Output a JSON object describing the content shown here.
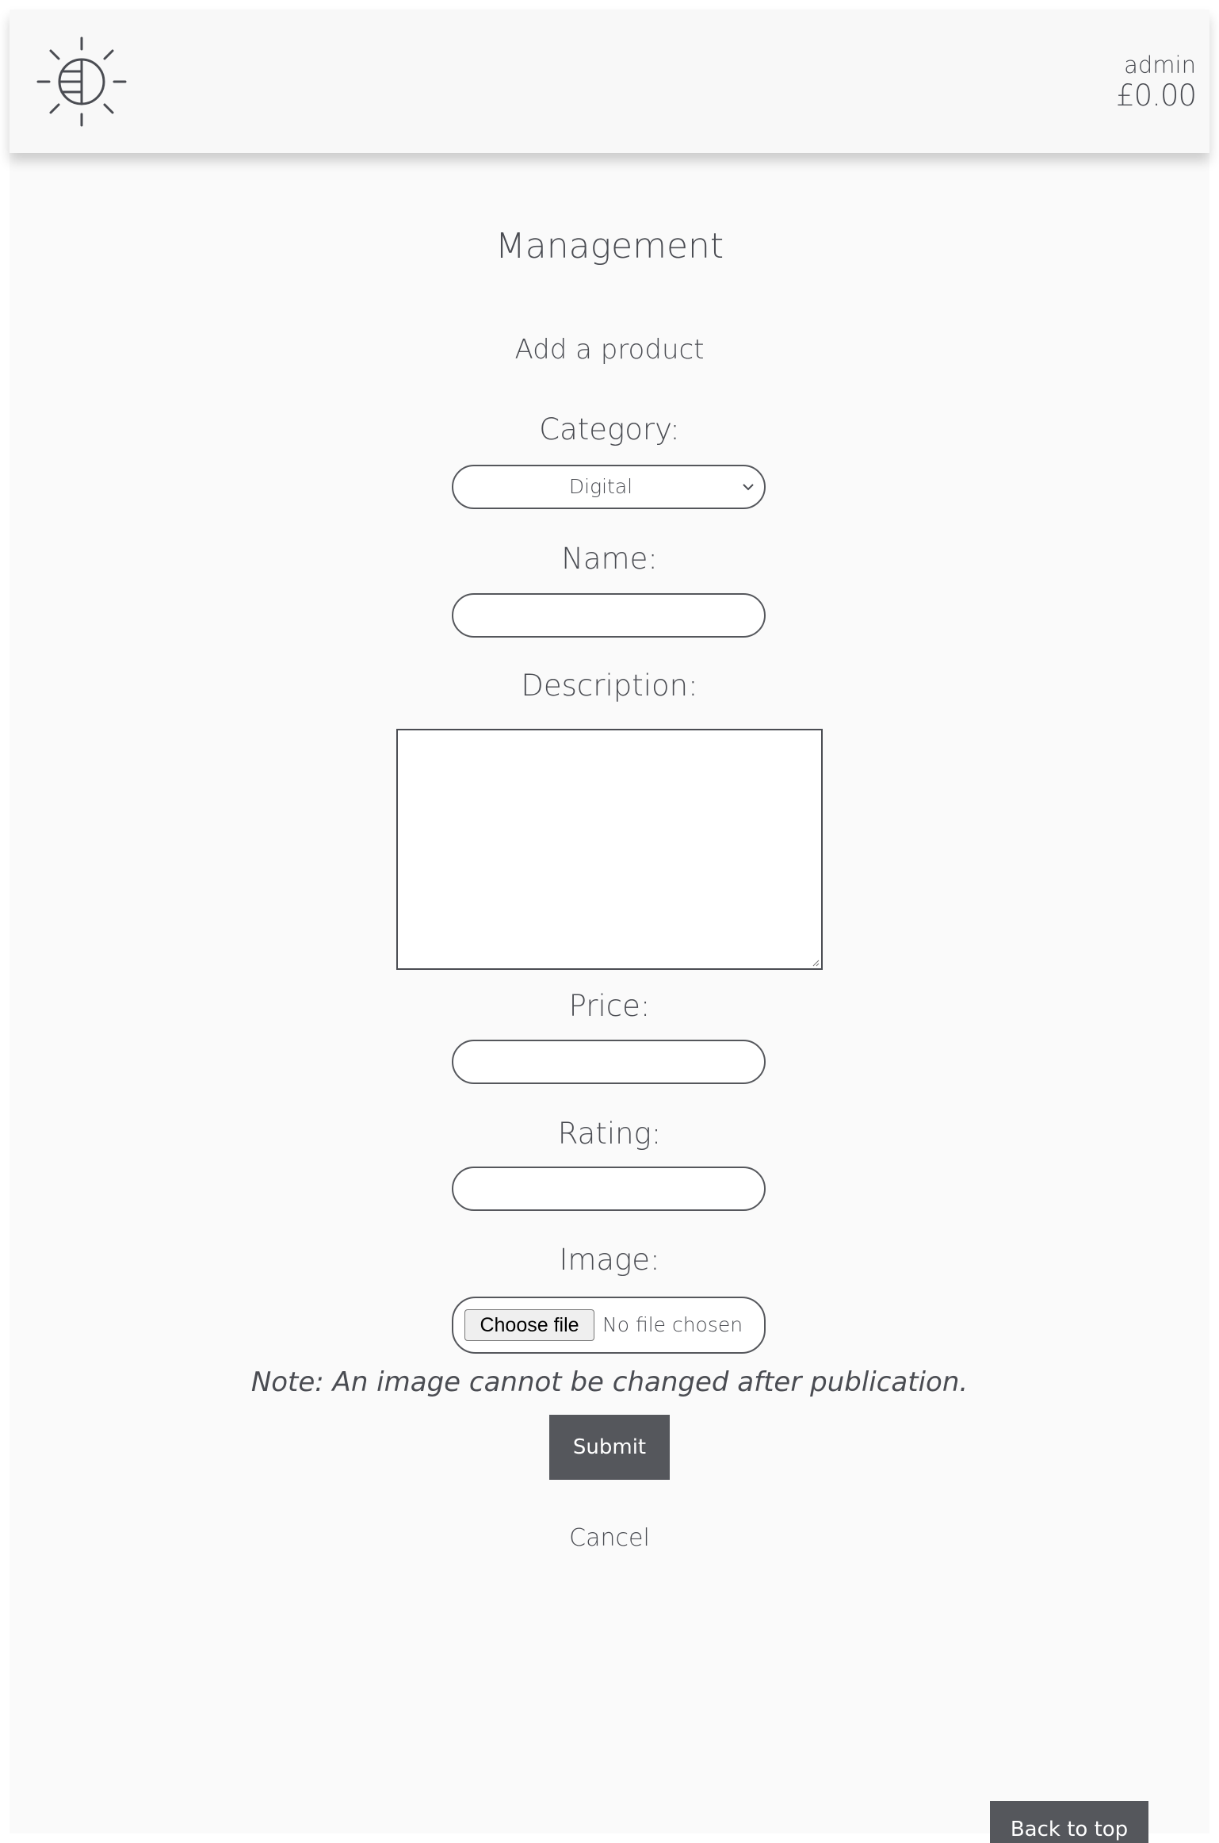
{
  "header": {
    "logo_icon": "brightness-contrast-icon",
    "user_name": "admin",
    "balance": "£0.00"
  },
  "page": {
    "title": "Management",
    "subtitle": "Add a product"
  },
  "form": {
    "category": {
      "label": "Category:",
      "selected": "Digital"
    },
    "name": {
      "label": "Name:",
      "value": ""
    },
    "description": {
      "label": "Description:",
      "value": ""
    },
    "price": {
      "label": "Price:",
      "value": ""
    },
    "rating": {
      "label": "Rating:",
      "value": ""
    },
    "image": {
      "label": "Image:",
      "button_label": "Choose file",
      "status": "No file chosen"
    },
    "note": "Note: An image cannot be changed after publication.",
    "submit_label": "Submit",
    "cancel_label": "Cancel"
  },
  "footer": {
    "back_to_top_label": "Back to top"
  },
  "colors": {
    "background": "#fafafa",
    "text": "#4a4c52",
    "button": "#55575c"
  }
}
